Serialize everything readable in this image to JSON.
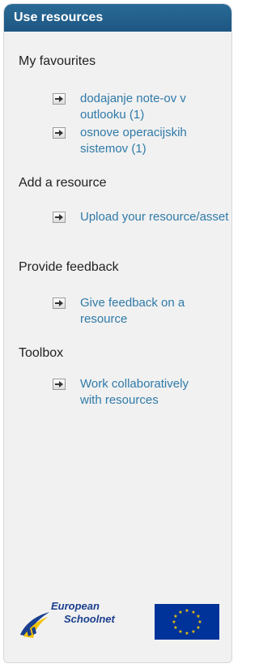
{
  "header": {
    "title": "Use resources"
  },
  "sections": [
    {
      "title": "My favourites",
      "links": [
        {
          "text": "dodajanje note-ov v outlooku (1)"
        },
        {
          "text": "osnove operacijskih sistemov (1)"
        }
      ]
    },
    {
      "title": "Add a resource",
      "links": [
        {
          "text": "Upload your resource/asset"
        }
      ]
    },
    {
      "title": "Provide feedback",
      "links": [
        {
          "text": "Give feedback on a resource"
        }
      ]
    },
    {
      "title": "Toolbox",
      "links": [
        {
          "text": "Work collaboratively with resources"
        }
      ]
    }
  ],
  "footer": {
    "logo_line1": "European",
    "logo_line2": "Schoolnet"
  },
  "icons": {
    "link_arrow": "right-arrow-icon"
  },
  "colors": {
    "header_bg": "#1e5682",
    "link": "#2f7aa8",
    "panel_bg": "#f1f1f1",
    "eu_blue": "#003399",
    "eu_star": "#ffcc00"
  }
}
